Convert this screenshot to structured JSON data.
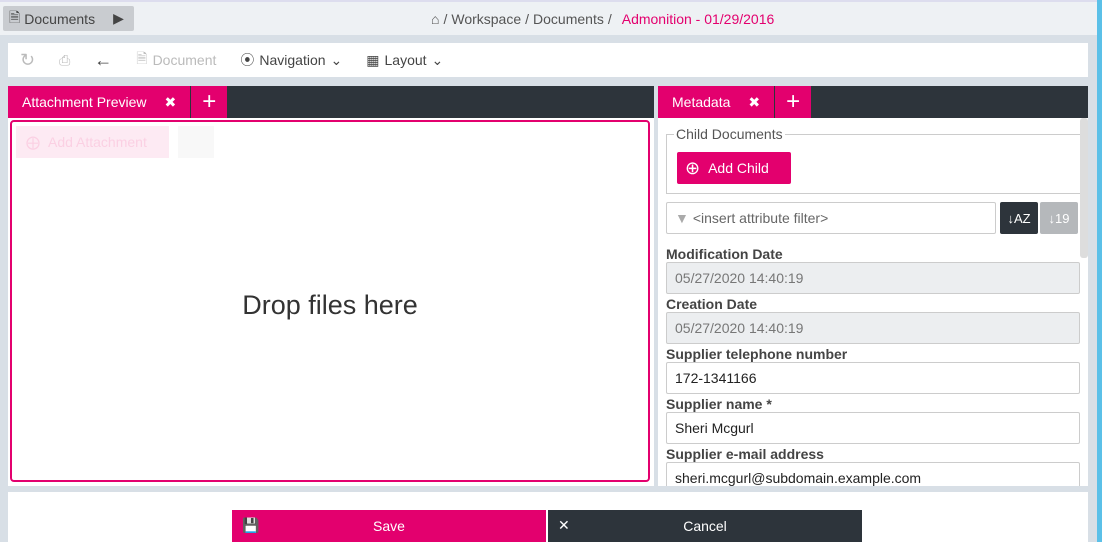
{
  "header": {
    "documents_label": "Documents",
    "breadcrumb": [
      "Workspace",
      "Documents"
    ],
    "current": "Admonition - 01/29/2016"
  },
  "toolbar": {
    "document": "Document",
    "navigation": "Navigation",
    "layout": "Layout"
  },
  "left_panel": {
    "tab": "Attachment Preview",
    "add_attachment": "Add Attachment",
    "drop_text": "Drop files here"
  },
  "right_panel": {
    "tab": "Metadata",
    "child_documents": "Child Documents",
    "add_child": "Add Child",
    "filter_placeholder": "<insert attribute filter>",
    "fields": [
      {
        "label": "Modification Date",
        "value": "05/27/2020 14:40:19",
        "readonly": true
      },
      {
        "label": "Creation Date",
        "value": "05/27/2020 14:40:19",
        "readonly": true
      },
      {
        "label": "Supplier telephone number",
        "value": "172-1341166",
        "readonly": false
      },
      {
        "label": "Supplier name *",
        "value": "Sheri Mcgurl",
        "readonly": false
      },
      {
        "label": "Supplier e-mail address",
        "value": "sheri.mcgurl@subdomain.example.com",
        "readonly": false
      }
    ]
  },
  "footer": {
    "save": "Save",
    "cancel": "Cancel"
  },
  "colors": {
    "accent": "#e3006e",
    "dark": "#2d343b"
  }
}
